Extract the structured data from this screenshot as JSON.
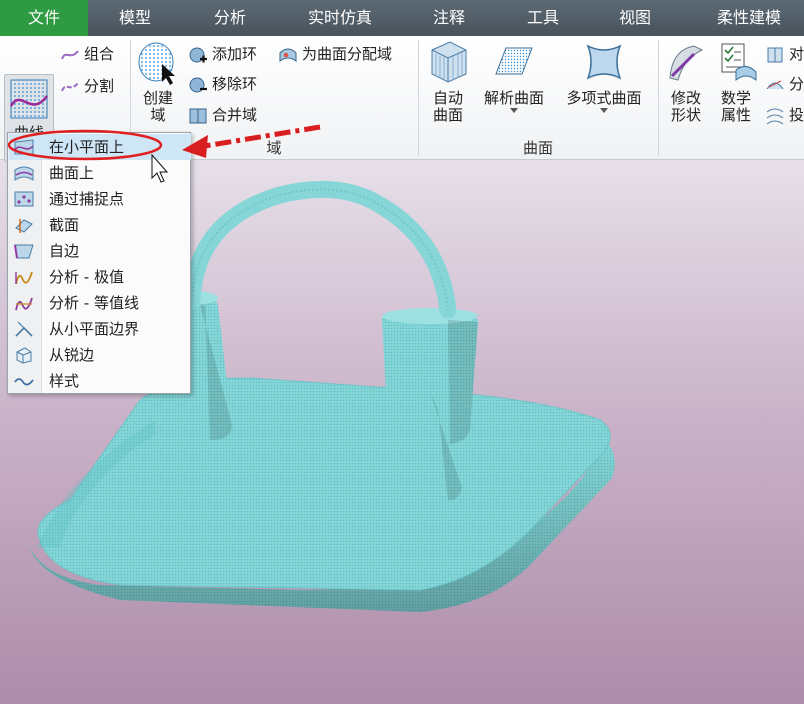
{
  "menu": {
    "tabs": [
      "文件",
      "模型",
      "分析",
      "实时仿真",
      "注释",
      "工具",
      "视图",
      "柔性建模"
    ]
  },
  "ribbon": {
    "curve": {
      "label": "曲线",
      "combine": "组合",
      "split": "分割"
    },
    "create_domain": {
      "label": "创建\n域"
    },
    "domain": {
      "add_loop": "添加环",
      "remove_loop": "移除环",
      "merge_domain": "合并域",
      "assign_domain": "为曲面分配域",
      "group_label": "域"
    },
    "surfaces": {
      "auto_surface": "自动\n曲面",
      "analytic_surface": "解析曲面",
      "polynomial_surface": "多项式曲面",
      "group_label": "曲面"
    },
    "modify_shape": "修改\n形状",
    "math_props": "数学\n属性",
    "partial": [
      "对",
      "分",
      "投"
    ]
  },
  "dropdown": {
    "items": [
      {
        "label": "在小平面上",
        "icon": "curve-on-facet-icon"
      },
      {
        "label": "曲面上",
        "icon": "curve-on-surface-icon"
      },
      {
        "label": "通过捕捉点",
        "icon": "snap-points-icon"
      },
      {
        "label": "截面",
        "icon": "section-icon"
      },
      {
        "label": "自边",
        "icon": "from-edge-icon"
      },
      {
        "label": "分析 - 极值",
        "icon": "extremum-icon"
      },
      {
        "label": "分析 - 等值线",
        "icon": "isoline-icon"
      },
      {
        "label": "从小平面边界",
        "icon": "facet-boundary-icon"
      },
      {
        "label": "从锐边",
        "icon": "sharp-edge-icon"
      },
      {
        "label": "样式",
        "icon": "style-curve-icon"
      }
    ],
    "selected_index": 0
  },
  "colors": {
    "menubar": "#4f5b64",
    "file_tab": "#2e9a41",
    "model": "#7fd3d5",
    "highlight_circle": "#e02020",
    "selected_item": "#cfe6f7"
  }
}
